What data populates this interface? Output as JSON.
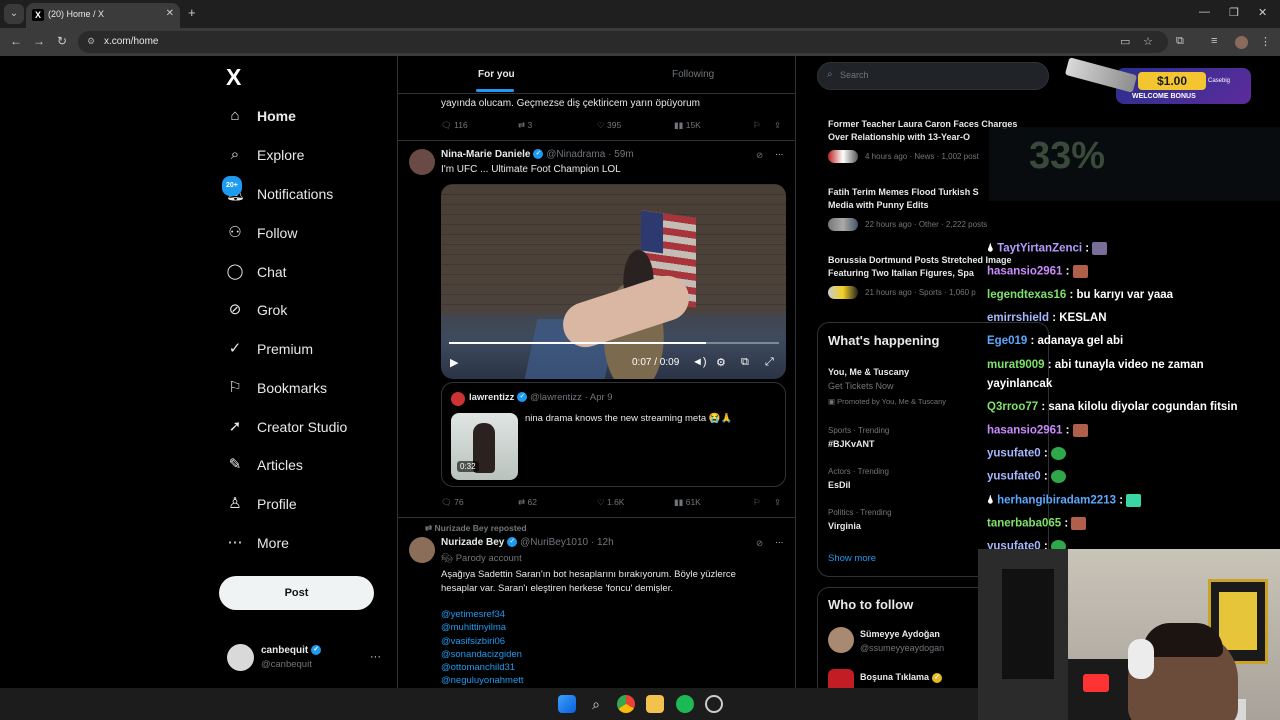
{
  "browser": {
    "tab_title": "(20) Home / X",
    "url": "x.com/home"
  },
  "nav": {
    "logo": "X",
    "items": [
      {
        "label": "Home",
        "icon": "home-icon"
      },
      {
        "label": "Explore",
        "icon": "search-icon"
      },
      {
        "label": "Notifications",
        "icon": "bell-icon",
        "badge": "20+"
      },
      {
        "label": "Follow",
        "icon": "person-add-icon"
      },
      {
        "label": "Chat",
        "icon": "chat-icon"
      },
      {
        "label": "Grok",
        "icon": "grok-icon"
      },
      {
        "label": "Premium",
        "icon": "premium-icon"
      },
      {
        "label": "Bookmarks",
        "icon": "bookmark-icon"
      },
      {
        "label": "Creator Studio",
        "icon": "rocket-icon"
      },
      {
        "label": "Articles",
        "icon": "articles-icon"
      },
      {
        "label": "Profile",
        "icon": "person-icon"
      },
      {
        "label": "More",
        "icon": "more-circle-icon"
      }
    ],
    "post_label": "Post",
    "account": {
      "name": "canbequit",
      "handle": "@canbequit"
    }
  },
  "feed": {
    "tabs": [
      "For you",
      "Following"
    ],
    "top_tweet": {
      "text_tail": "yayında olucam. Geçmezse diş çektiricem yarın öpüyorum",
      "replies": "116",
      "reposts": "3",
      "likes": "395",
      "views": "15K"
    },
    "tweet1": {
      "name": "Nina-Marie Daniele",
      "handle": "@Ninadrama",
      "time": "· 59m",
      "text": "I'm UFC ... Ultimate Foot Champion LOL",
      "video_time": "0:07 / 0:09",
      "video_progress": 0.78,
      "quote": {
        "name": "lawrentizz",
        "handle": "@lawrentizz",
        "time": "· Apr 9",
        "text": "nina drama knows the new streaming meta 😭🙏",
        "duration": "0:32"
      },
      "replies": "76",
      "reposts": "62",
      "likes": "1.6K",
      "views": "61K"
    },
    "tweet2": {
      "reposted_by": "Nurizade Bey reposted",
      "name": "Nurizade Bey",
      "handle": "@NuriBey1010",
      "time": "· 12h",
      "parody": "Parody account",
      "text1": "Aşağıya Sadettin Saran'ın bot hesaplarını bırakıyorum. Böyle yüzlerce",
      "text2": "hesaplar var. Saran'ı eleştiren herkese 'foncu' demişler.",
      "mentions": [
        "@yetimesref34",
        "@muhittinyilma",
        "@vasifsizbiri06",
        "@sonandacizgiden",
        "@ottomanchild31",
        "@neguluyonahmett"
      ]
    }
  },
  "right": {
    "search_placeholder": "Search",
    "news": [
      {
        "title1": "Former Teacher Laura Caron Faces Charges",
        "title2": "Over Relationship with 13-Year-O",
        "meta": "4 hours ago · News · 1,002 post"
      },
      {
        "title1": "Fatih Terim Memes Flood Turkish S",
        "title2": "Media with Punny Edits",
        "meta": "22 hours ago · Other · 2,222 posts"
      },
      {
        "title1": "Borussia Dortmund Posts Stretched Image",
        "title2": "Featuring Two Italian Figures, Spa",
        "meta": "21 hours ago · Sports · 1,060 p"
      }
    ],
    "happening": {
      "title": "What's happening",
      "items": [
        {
          "t": "You, Me & Tuscany",
          "s": "Get Tickets Now",
          "p": "Promoted by You, Me & Tuscany"
        },
        {
          "cat": "Sports · Trending",
          "t": "#BJKvANT"
        },
        {
          "cat": "Actors · Trending",
          "t": "EsDil"
        },
        {
          "cat": "Politics · Trending",
          "t": "Virginia"
        }
      ],
      "show_more": "Show more"
    },
    "who_to_follow": {
      "title": "Who to follow",
      "users": [
        {
          "name": "Sümeyye Aydoğan",
          "handle": "@ssumeyyeaydogan"
        },
        {
          "name": "Boşuna Tıklama",
          "handle": ""
        }
      ]
    }
  },
  "overlay": {
    "promo_amount": "$1.00",
    "promo_text": "WELCOME BONUS",
    "promo_brand": "Casebig",
    "percent": "33%",
    "chat": [
      {
        "user": "TaytYirtanZenci",
        "color": "#b39cff",
        "msg": ""
      },
      {
        "user": "hasansio2961",
        "color": "#c98cff",
        "msg": ""
      },
      {
        "user": "legendtexas16",
        "color": "#7ee26a",
        "msg": "bu karıyı var yaaa"
      },
      {
        "user": "emirrshield",
        "color": "#a6b8ff",
        "msg": "KESLAN"
      },
      {
        "user": "Ege019",
        "color": "#5aa8ff",
        "msg": "adanaya gel abi"
      },
      {
        "user": "murat9009",
        "color": "#7ee26a",
        "msg": "abi tunayla video ne zaman yayinlancak"
      },
      {
        "user": "Q3rroo77",
        "color": "#7ee26a",
        "msg": "sana kilolu diyolar cogundan fitsin"
      },
      {
        "user": "hasansio2961",
        "color": "#c98cff",
        "msg": ""
      },
      {
        "user": "yusufate0",
        "color": "#a6b8ff",
        "msg": ""
      },
      {
        "user": "yusufate0",
        "color": "#a6b8ff",
        "msg": ""
      },
      {
        "user": "herhangibiradam2213",
        "color": "#5aa8ff",
        "msg": ""
      },
      {
        "user": "tanerbaba065",
        "color": "#7ee26a",
        "msg": ""
      },
      {
        "user": "yusufate0",
        "color": "#a6b8ff",
        "msg": ""
      }
    ]
  }
}
